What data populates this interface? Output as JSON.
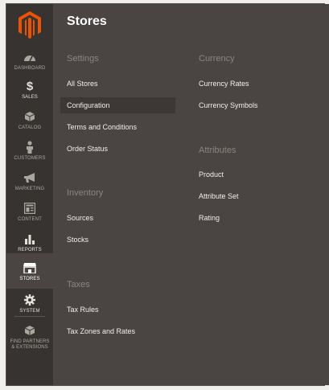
{
  "colors": {
    "accent": "#eb5202",
    "sidebar": "#373330",
    "panel": "#4a4542",
    "active_item": "#3d3835"
  },
  "sidebar": {
    "items": [
      {
        "label": "DASHBOARD",
        "icon": "dashboard-gauge-icon"
      },
      {
        "label": "SALES",
        "icon": "dollar-icon"
      },
      {
        "label": "CATALOG",
        "icon": "cube-icon"
      },
      {
        "label": "CUSTOMERS",
        "icon": "person-icon"
      },
      {
        "label": "MARKETING",
        "icon": "megaphone-icon"
      },
      {
        "label": "CONTENT",
        "icon": "layout-icon"
      },
      {
        "label": "REPORTS",
        "icon": "bar-chart-icon"
      },
      {
        "label": "STORES",
        "icon": "storefront-icon"
      },
      {
        "label": "SYSTEM",
        "icon": "gear-icon"
      },
      {
        "label": "FIND PARTNERS & EXTENSIONS",
        "icon": "cube-box-icon"
      }
    ]
  },
  "panel": {
    "title": "Stores",
    "settings": {
      "heading": "Settings",
      "links": [
        "All Stores",
        "Configuration",
        "Terms and Conditions",
        "Order Status"
      ]
    },
    "inventory": {
      "heading": "Inventory",
      "links": [
        "Sources",
        "Stocks"
      ]
    },
    "taxes": {
      "heading": "Taxes",
      "links": [
        "Tax Rules",
        "Tax Zones and Rates"
      ]
    },
    "currency": {
      "heading": "Currency",
      "links": [
        "Currency Rates",
        "Currency Symbols"
      ]
    },
    "attributes": {
      "heading": "Attributes",
      "links": [
        "Product",
        "Attribute Set",
        "Rating"
      ]
    }
  }
}
